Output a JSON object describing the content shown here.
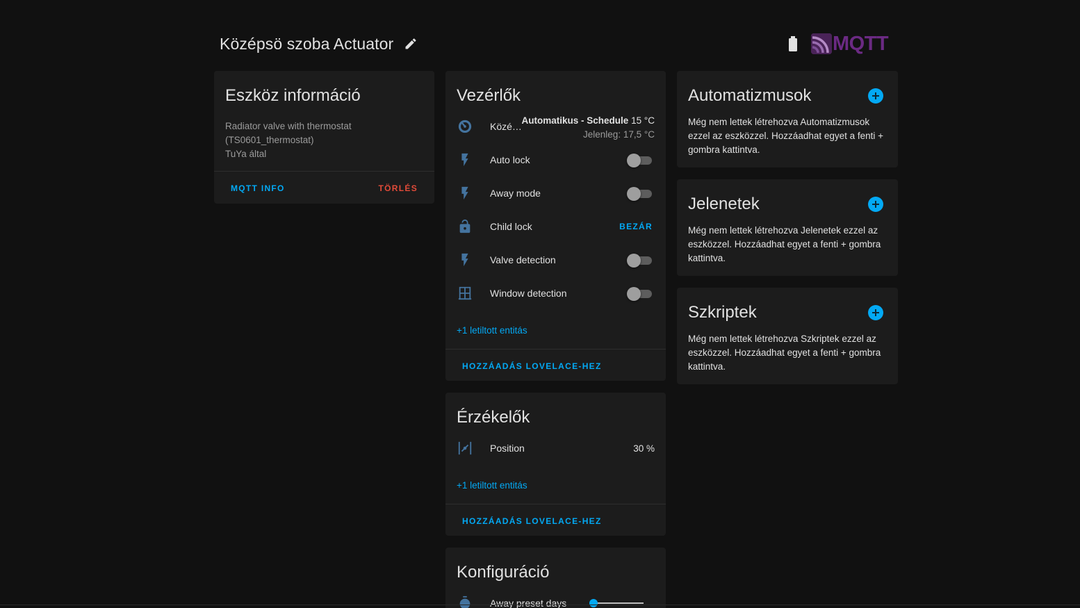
{
  "header": {
    "title": "Középsö szoba Actuator",
    "logo_text": "MQTT"
  },
  "device_info": {
    "title": "Eszköz információ",
    "line1": "Radiator valve with thermostat",
    "line2": "(TS0601_thermostat)",
    "line3": "TuYa által",
    "mqtt_info_label": "MQTT INFO",
    "delete_label": "TÖRLÉS"
  },
  "controls": {
    "title": "Vezérlők",
    "climate": {
      "name": "Közé…",
      "mode_label": "Automatikus - Schedule",
      "target": "15 °C",
      "current": "Jelenleg: 17,5 °C"
    },
    "items": [
      {
        "name": "Auto lock",
        "icon": "flash-icon",
        "state": "off"
      },
      {
        "name": "Away mode",
        "icon": "flash-icon",
        "state": "off"
      },
      {
        "name": "Child lock",
        "icon": "lock-open-icon",
        "action": "BEZÁR"
      },
      {
        "name": "Valve detection",
        "icon": "flash-icon",
        "state": "off"
      },
      {
        "name": "Window detection",
        "icon": "window-icon",
        "state": "off"
      }
    ],
    "disabled_link": "+1 letiltott entitás",
    "add_lovelace": "HOZZÁADÁS LOVELACE-HEZ"
  },
  "sensors": {
    "title": "Érzékelők",
    "items": [
      {
        "name": "Position",
        "icon": "valve-icon",
        "value": "30 %"
      }
    ],
    "disabled_link": "+1 letiltott entitás",
    "add_lovelace": "HOZZÁADÁS LOVELACE-HEZ"
  },
  "configuration": {
    "title": "Konfiguráció",
    "items": [
      {
        "name": "Away preset days",
        "icon": "timer-icon",
        "slider_fraction": 0.0
      }
    ]
  },
  "automations": {
    "title": "Automatizmusok",
    "text": "Még nem lettek létrehozva Automatizmusok ezzel az eszközzel. Hozzáadhat egyet a fenti + gombra kattintva."
  },
  "scenes": {
    "title": "Jelenetek",
    "text": "Még nem lettek létrehozva Jelenetek ezzel az eszközzel. Hozzáadhat egyet a fenti + gombra kattintva."
  },
  "scripts": {
    "title": "Szkriptek",
    "text": "Még nem lettek létrehozva Szkriptek ezzel az eszközzel. Hozzáadhat egyet a fenti + gombra kattintva."
  },
  "colors": {
    "accent": "#03a9f4",
    "danger": "#e24b39",
    "icon": "#44739e",
    "card": "#1c1c1c",
    "background": "#111111",
    "logo": "#6b2a83"
  }
}
